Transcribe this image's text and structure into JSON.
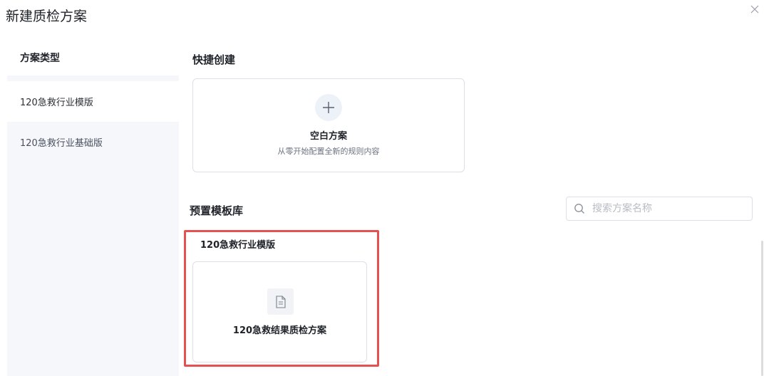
{
  "dialog": {
    "title": "新建质检方案"
  },
  "sidebar": {
    "header": "方案类型",
    "items": [
      {
        "label": "120急救行业模版",
        "active": true
      },
      {
        "label": "120急救行业基础版",
        "active": false
      }
    ]
  },
  "quick_create": {
    "title": "快捷创建",
    "blank_card": {
      "title": "空白方案",
      "description": "从零开始配置全新的规则内容",
      "icon": "plus-icon"
    }
  },
  "template_library": {
    "title": "预置模板库",
    "search": {
      "placeholder": "搜索方案名称",
      "value": ""
    },
    "groups": [
      {
        "name": "120急救行业模版",
        "templates": [
          {
            "name": "120急救结果质检方案",
            "icon": "document-icon"
          }
        ]
      }
    ]
  },
  "colors": {
    "highlight": "#e55050",
    "sidebar_bg": "#f5f7fa",
    "border": "#dcdfe6"
  }
}
